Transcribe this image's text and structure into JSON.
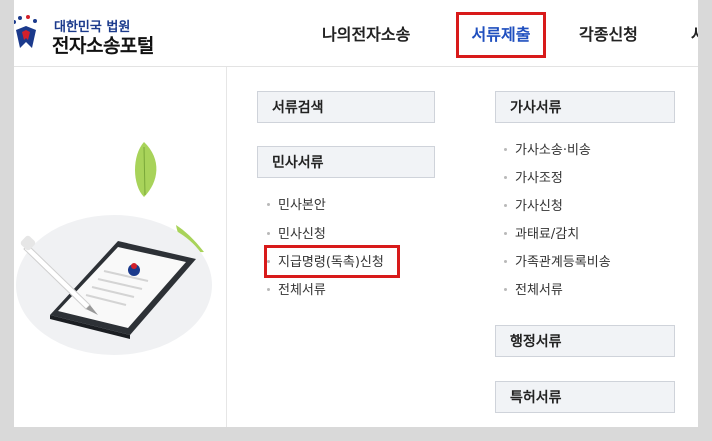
{
  "logo": {
    "small_text": "대한민국 법원",
    "big_text": "전자소송포털"
  },
  "nav": {
    "my_litigation": "나의전자소송",
    "submit_documents": "서류제출",
    "various_applications": "각종신청",
    "more_cut": "사"
  },
  "menu": {
    "left": {
      "search_docs": "서류검색",
      "civil_docs": "민사서류",
      "civil_items": [
        "민사본안",
        "민사신청",
        "지급명령(독촉)신청",
        "전체서류"
      ]
    },
    "right": {
      "family_docs": "가사서류",
      "family_items": [
        "가사소송·비송",
        "가사조정",
        "가사신청",
        "과태료/감치",
        "가족관계등록비송",
        "전체서류"
      ],
      "admin_docs": "행정서류",
      "patent_docs": "특허서류"
    }
  },
  "colors": {
    "accent": "#1f4fbf",
    "highlight": "#d81a1a"
  }
}
